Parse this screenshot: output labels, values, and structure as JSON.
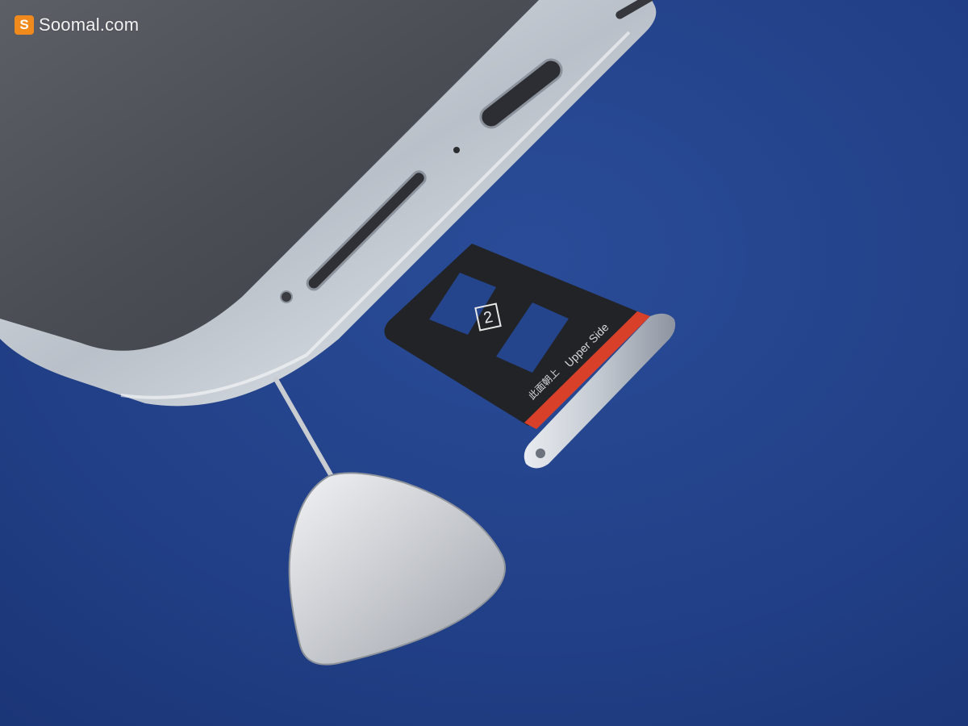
{
  "watermark": {
    "logo_letter": "S",
    "site": "Soomal.com"
  },
  "sim_tray": {
    "slot_number": "2",
    "side_label": "Upper Side",
    "cjk_label": "此面朝上"
  },
  "colors": {
    "background": "#22428c",
    "logo_orange": "#f08a1c",
    "tray_red": "#d8402a",
    "metal": "#cfd4da"
  }
}
